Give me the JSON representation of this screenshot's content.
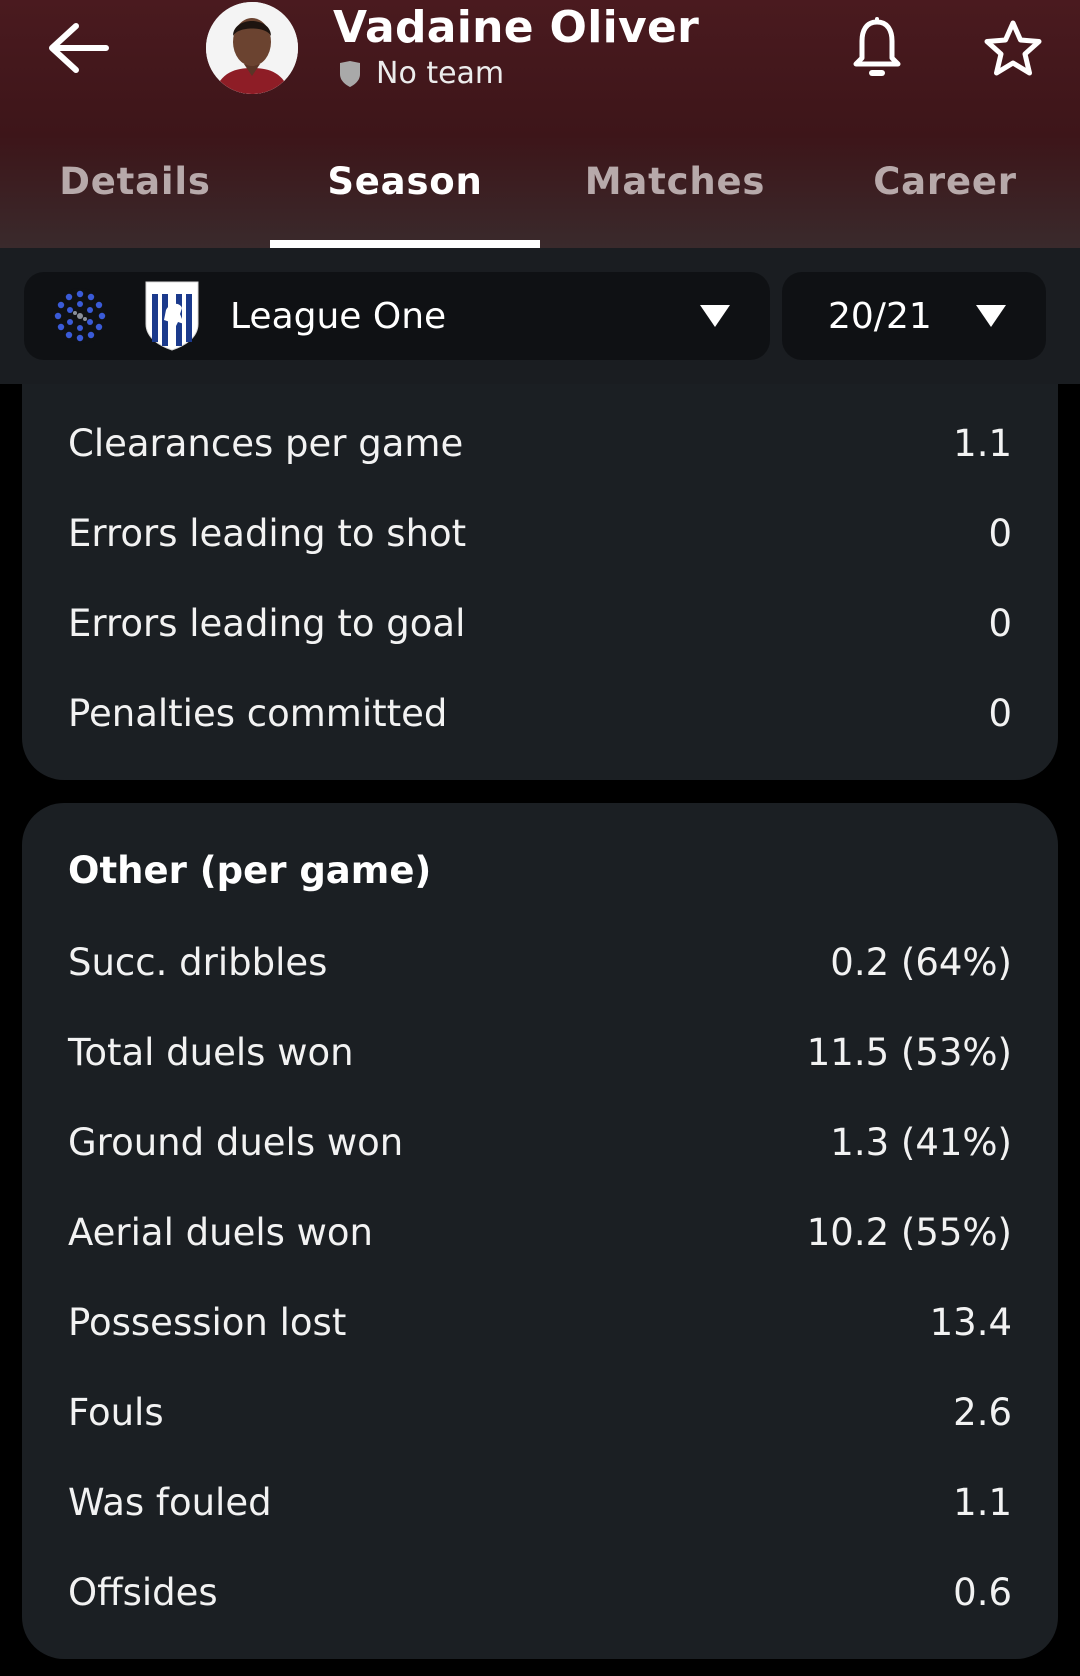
{
  "player": {
    "name": "Vadaine Oliver",
    "team": "No team"
  },
  "tabs": [
    "Details",
    "Season",
    "Matches",
    "Career"
  ],
  "active_tab": "Season",
  "filters": {
    "league": "League One",
    "season": "20/21"
  },
  "defending_rows": [
    {
      "label": "Clearances per game",
      "value": "1.1"
    },
    {
      "label": "Errors leading to shot",
      "value": "0"
    },
    {
      "label": "Errors leading to goal",
      "value": "0"
    },
    {
      "label": "Penalties committed",
      "value": "0"
    }
  ],
  "other": {
    "title": "Other (per game)",
    "rows": [
      {
        "label": "Succ. dribbles",
        "value": "0.2 (64%)"
      },
      {
        "label": "Total duels won",
        "value": "11.5 (53%)"
      },
      {
        "label": "Ground duels won",
        "value": "1.3 (41%)"
      },
      {
        "label": "Aerial duels won",
        "value": "10.2 (55%)"
      },
      {
        "label": "Possession lost",
        "value": "13.4"
      },
      {
        "label": "Fouls",
        "value": "2.6"
      },
      {
        "label": "Was fouled",
        "value": "1.1"
      },
      {
        "label": "Offsides",
        "value": "0.6"
      }
    ]
  },
  "icons": {
    "back": "arrow-left-icon",
    "team_badge": "shield-icon",
    "notifications": "bell-icon",
    "favorite": "star-icon",
    "league_logo": "league-one-logo",
    "club_crest": "gillingham-crest",
    "dropdown": "chevron-down-icon"
  },
  "colors": {
    "header": "#4a1a1f",
    "card": "#1b1f23",
    "background": "#000000",
    "tab_indicator": "#ffffff"
  }
}
